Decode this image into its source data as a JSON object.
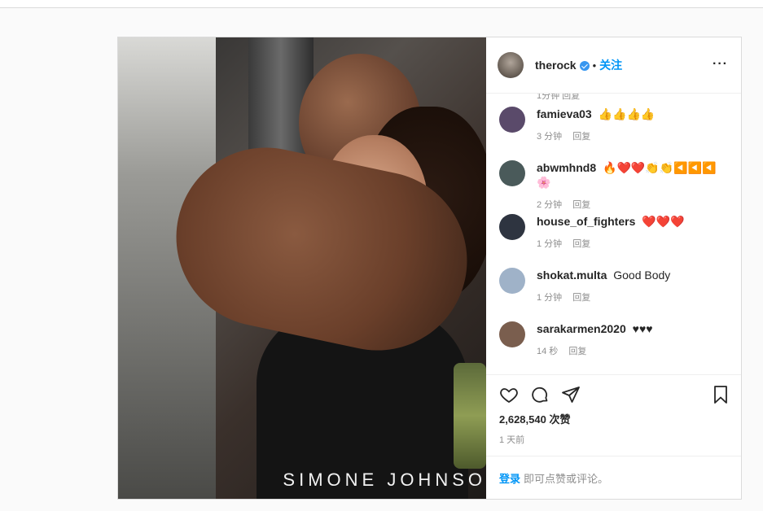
{
  "post": {
    "caption": "SIMONE JOHNSO",
    "owner": {
      "username": "therock",
      "separator": "•",
      "follow": "关注",
      "more": "···"
    },
    "cut_meta": "1分钟 回复",
    "comments": [
      {
        "user": "famieva03",
        "text": "👍👍👍👍",
        "age": "3 分钟",
        "reply": "回复",
        "avatar_color": "#5a4a6a"
      },
      {
        "user": "abwmhnd8",
        "text": "🔥❤️❤️👏👏◀️◀️◀️🌸",
        "age": "2 分钟",
        "reply": "回复",
        "avatar_color": "#4a5a5a"
      },
      {
        "user": "house_of_fighters",
        "text": "❤️❤️❤️",
        "age": "1 分钟",
        "reply": "回复",
        "avatar_color": "#2e3440"
      },
      {
        "user": "shokat.multa",
        "text": "Good Body",
        "age": "1 分钟",
        "reply": "回复",
        "avatar_color": "#9fb2c8"
      },
      {
        "user": "sarakarmen2020",
        "text": "♥♥♥",
        "age": "14 秒",
        "reply": "回复",
        "avatar_color": "#7a5e4e"
      }
    ],
    "likes": "2,628,540 次赞",
    "time": "1 天前",
    "login_link": "登录",
    "login_text": "即可点赞或评论。"
  },
  "colors": {
    "accent": "#0095f6",
    "verified": "#3897f0"
  },
  "icons": [
    "heart-icon",
    "comment-icon",
    "share-icon",
    "bookmark-icon",
    "verified-icon",
    "more-icon"
  ]
}
